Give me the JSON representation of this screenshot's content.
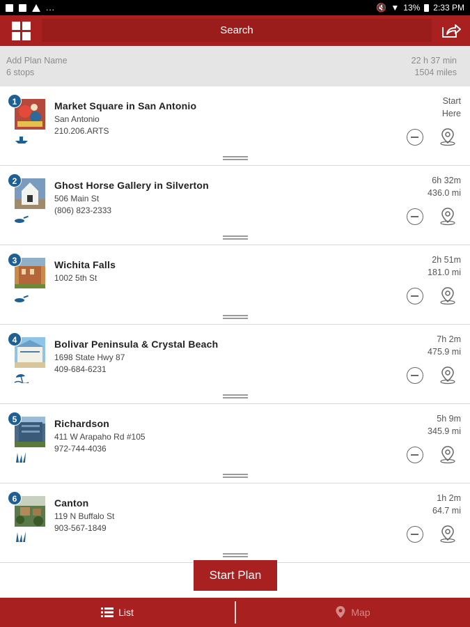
{
  "status_bar": {
    "dots": "...",
    "battery": "13%",
    "time": "2:33 PM"
  },
  "app_bar": {
    "search_label": "Search",
    "menu_icon": "grid-icon",
    "share_icon": "share-icon"
  },
  "plan": {
    "name_placeholder": "Add Plan Name",
    "stops_count": "6 stops",
    "total_time": "22 h 37 min",
    "total_distance": "1504 miles"
  },
  "stops": [
    {
      "number": "1",
      "name": "Market Square in San Antonio",
      "address": "San Antonio",
      "phone": "210.206.ARTS",
      "dist_line1": "Start",
      "dist_line2": "Here",
      "category_icon": "boat-icon"
    },
    {
      "number": "2",
      "name": "Ghost Horse Gallery in Silverton",
      "address": "506 Main St",
      "phone": "(806) 823-2333",
      "dist_line1": "6h 32m",
      "dist_line2": "436.0 mi",
      "category_icon": "frying-pan-icon"
    },
    {
      "number": "3",
      "name": "Wichita Falls",
      "address": "1002 5th St",
      "phone": "",
      "dist_line1": "2h 51m",
      "dist_line2": "181.0 mi",
      "category_icon": "frying-pan-icon"
    },
    {
      "number": "4",
      "name": "Bolivar Peninsula & Crystal Beach",
      "address": "1698 State Hwy 87",
      "phone": "409-684-6231",
      "dist_line1": "7h 2m",
      "dist_line2": "475.9 mi",
      "category_icon": "beach-umbrella-icon"
    },
    {
      "number": "5",
      "name": "Richardson",
      "address": "411 W Arapaho Rd #105",
      "phone": "972-744-4036",
      "dist_line1": "5h 9m",
      "dist_line2": "345.9 mi",
      "category_icon": "grass-icon"
    },
    {
      "number": "6",
      "name": "Canton",
      "address": "119 N Buffalo St",
      "phone": "903-567-1849",
      "dist_line1": "1h 2m",
      "dist_line2": "64.7 mi",
      "category_icon": "grass-icon"
    }
  ],
  "start_button": "Start Plan",
  "bottom_tabs": {
    "list_label": "List",
    "map_label": "Map"
  },
  "colors": {
    "brand_red": "#a8201f",
    "badge_blue": "#1e5f94",
    "header_gray": "#e5e5e5"
  }
}
